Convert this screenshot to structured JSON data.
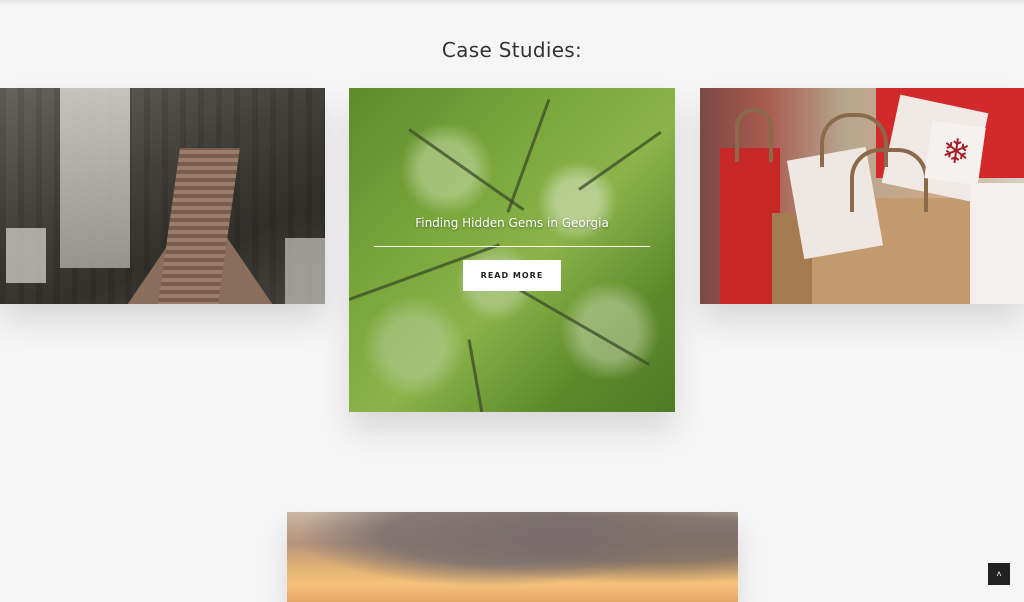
{
  "section": {
    "title": "Case Studies:"
  },
  "cards": [
    {
      "image": "city-aerial-photo"
    },
    {
      "image": "forest-canopy-photo",
      "overlay_title": "Finding Hidden Gems in Georgia",
      "button_label": "READ MORE"
    },
    {
      "image": "shopping-bags-photo",
      "tag_glyph": "❄"
    },
    {
      "image": "sunset-sky-photo"
    }
  ],
  "scroll_top": {
    "icon": "chevron-up-icon",
    "glyph": "˄"
  }
}
